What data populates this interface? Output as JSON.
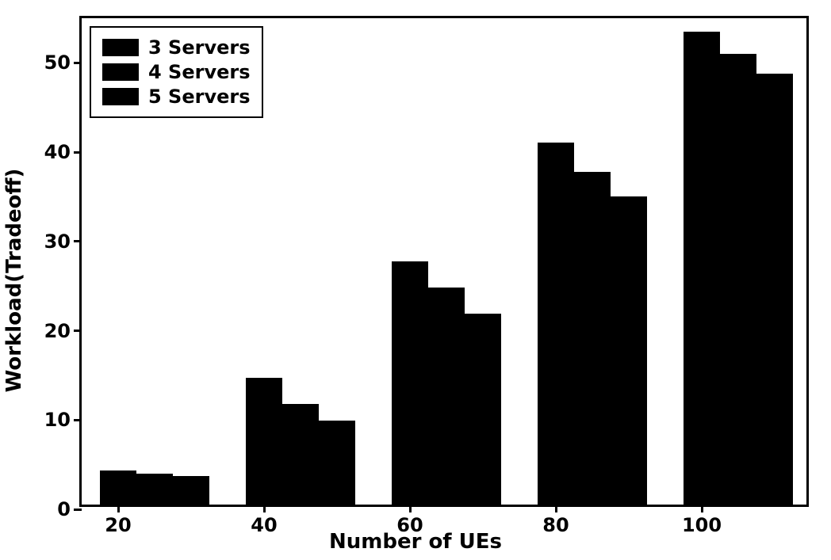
{
  "chart_data": {
    "type": "bar",
    "title": "",
    "xlabel": "Number of UEs",
    "ylabel": "Workload(Tradeoff)",
    "categories": [
      "20",
      "40",
      "60",
      "80",
      "100"
    ],
    "series": [
      {
        "name": "3 Servers",
        "values": [
          3.8,
          14.2,
          27.2,
          40.5,
          53.0
        ]
      },
      {
        "name": "4 Servers",
        "values": [
          3.5,
          11.3,
          24.3,
          37.3,
          50.5
        ]
      },
      {
        "name": "5 Servers",
        "values": [
          3.2,
          9.4,
          21.4,
          34.5,
          48.3
        ]
      }
    ],
    "ylim": [
      0,
      55
    ],
    "yticks": [
      0,
      10,
      20,
      30,
      40,
      50
    ],
    "xticks_labels": [
      "20",
      "40",
      "60",
      "80",
      "100"
    ],
    "legend_position": "upper-left"
  }
}
